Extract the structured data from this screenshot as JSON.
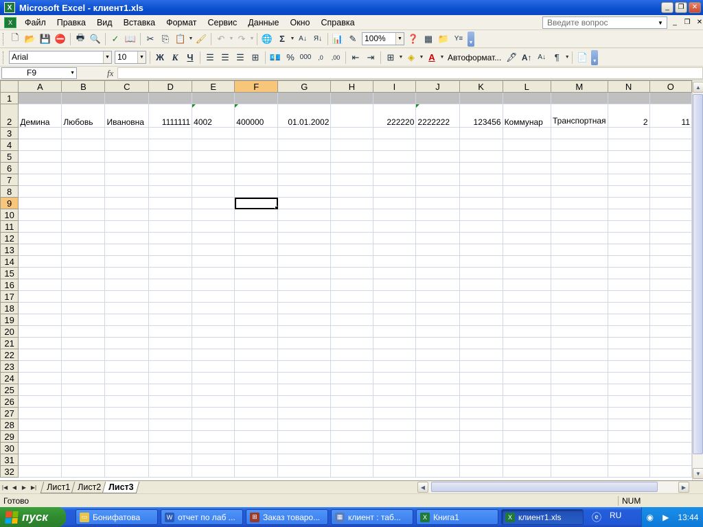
{
  "window": {
    "title": "Microsoft Excel - клиент1.xls",
    "app_icon": "excel-icon"
  },
  "menu": {
    "items": [
      "Файл",
      "Правка",
      "Вид",
      "Вставка",
      "Формат",
      "Сервис",
      "Данные",
      "Окно",
      "Справка"
    ],
    "help_placeholder": "Введите вопрос"
  },
  "toolbar_standard": {
    "zoom": "100%"
  },
  "toolbar_format": {
    "font": "Arial",
    "size": "10",
    "bold": "Ж",
    "italic": "К",
    "underline": "Ч",
    "percent": "%",
    "thousands": "000",
    "autoformat": "Автоформат..."
  },
  "formula_bar": {
    "name_box": "F9",
    "fx": "fx",
    "formula": ""
  },
  "grid": {
    "columns": [
      "A",
      "B",
      "C",
      "D",
      "E",
      "F",
      "G",
      "H",
      "I",
      "J",
      "K",
      "L",
      "M",
      "N",
      "O"
    ],
    "active_column": "F",
    "active_row": 9,
    "row2": [
      "Демина",
      "Любовь",
      "Ивановна",
      "1111111",
      "4002",
      "400000",
      "01.01.2002",
      "",
      "222220",
      "2222222",
      "123456",
      "Коммунар",
      "Транспортная",
      "2",
      "11"
    ],
    "row_numbers": [
      1,
      2,
      3,
      4,
      5,
      6,
      7,
      8,
      9,
      10,
      11,
      12,
      13,
      14,
      15,
      16,
      17,
      18,
      19,
      20,
      21,
      22,
      23,
      24,
      25,
      26,
      27,
      28,
      29,
      30,
      31,
      32
    ]
  },
  "sheets": {
    "tabs": [
      "Лист1",
      "Лист2",
      "Лист3"
    ],
    "active": "Лист3"
  },
  "status": {
    "text": "Готово",
    "num": "NUM"
  },
  "taskbar": {
    "start": "пуск",
    "tasks": [
      {
        "label": "Бонифатова",
        "icon": "folder-icon",
        "color": "#e8c44a"
      },
      {
        "label": "отчет по лаб ...",
        "icon": "word-icon",
        "color": "#2a5ab8"
      },
      {
        "label": "Заказ товаро...",
        "icon": "access-icon",
        "color": "#9a3a2a"
      },
      {
        "label": "клиент : таб...",
        "icon": "table-icon",
        "color": "#5a7ab8"
      },
      {
        "label": "Книга1",
        "icon": "excel-icon",
        "color": "#1f7a3a"
      },
      {
        "label": "клиент1.xls",
        "icon": "excel-icon",
        "color": "#1f7a3a"
      }
    ],
    "active_task": "клиент1.xls",
    "lang": "RU",
    "clock": "13:44"
  }
}
